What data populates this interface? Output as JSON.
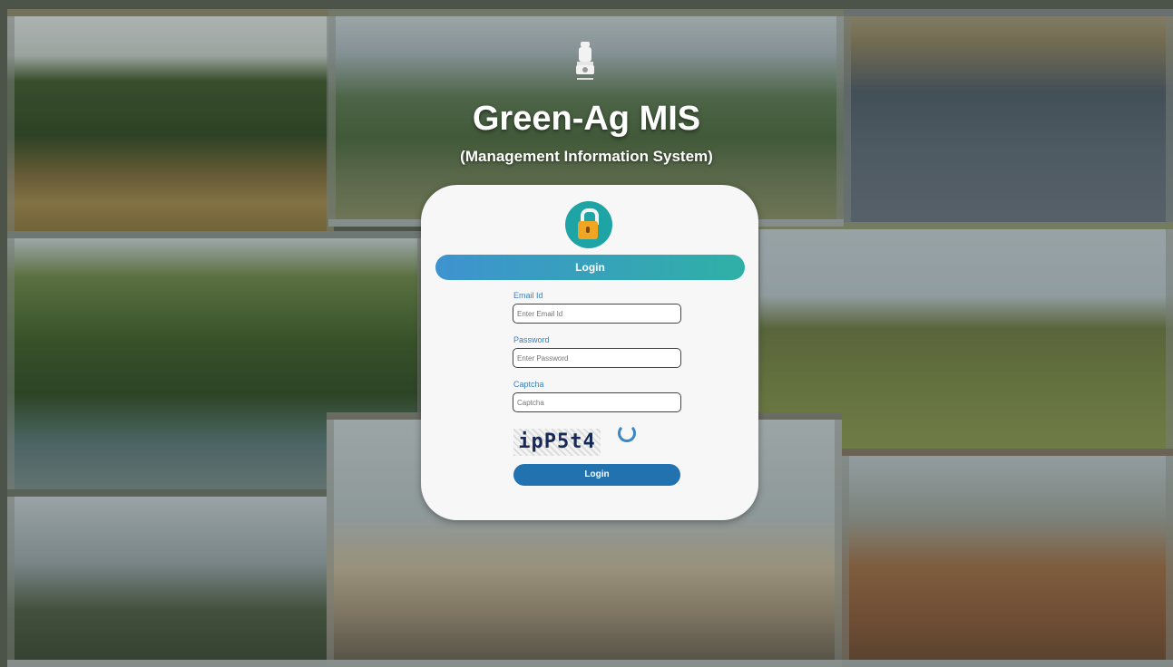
{
  "header": {
    "title": "Green-Ag MIS",
    "subtitle": "(Management Information System)"
  },
  "form": {
    "banner_label": "Login",
    "email": {
      "label": "Email Id",
      "placeholder": "Enter Email Id",
      "value": ""
    },
    "password": {
      "label": "Password",
      "placeholder": "Enter Password",
      "value": ""
    },
    "captcha": {
      "label": "Captcha",
      "placeholder": "Captcha",
      "value": "",
      "image_text": "ipP5t4"
    },
    "submit_label": "Login"
  },
  "colors": {
    "banner_start": "#3e93cf",
    "banner_end": "#2fb0a6",
    "button": "#2372b0",
    "lock_circle": "#1ea4a4",
    "lock_body": "#f0a623",
    "label_text": "#3b7fc0"
  },
  "icons": {
    "emblem": "national-emblem-icon",
    "lock": "padlock-icon",
    "refresh": "refresh-icon"
  }
}
